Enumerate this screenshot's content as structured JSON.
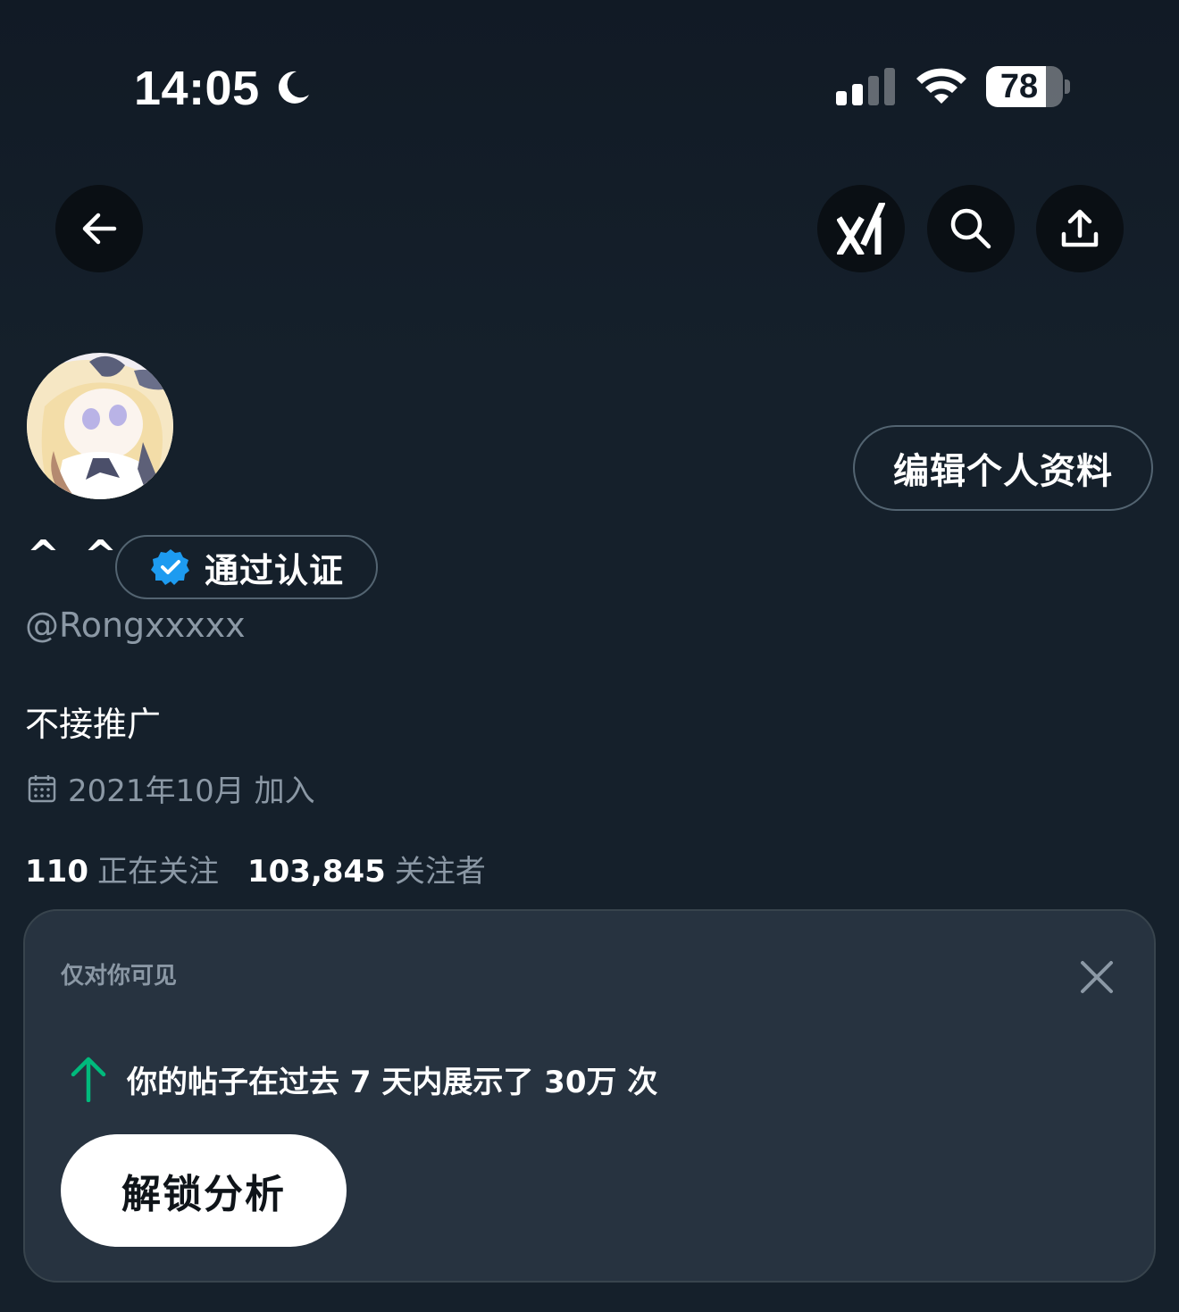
{
  "status_bar": {
    "time": "14:05",
    "battery_level": "78",
    "battery_fraction": 0.78
  },
  "nav": {
    "icons": [
      "back-arrow-icon",
      "grok-icon",
      "search-icon",
      "share-icon"
    ]
  },
  "profile": {
    "display_name": "^ ^",
    "verified_label": "通过认证",
    "handle": "@Rongxxxxx",
    "bio": "不接推广",
    "joined": "2021年10月 加入",
    "edit_button": "编辑个人资料",
    "following_count": "110",
    "following_label": "正在关注",
    "followers_count": "103,845",
    "followers_label": "关注者"
  },
  "analytics_card": {
    "visibility_tag": "仅对你可见",
    "message": "你的帖子在过去 7 天内展示了 30万 次",
    "unlock_button": "解锁分析"
  },
  "colors": {
    "background": "#15202b",
    "card_background": "#273340",
    "verified_blue": "#1d9bf0",
    "growth_green": "#00ba7c",
    "muted_text": "#8b98a5"
  }
}
